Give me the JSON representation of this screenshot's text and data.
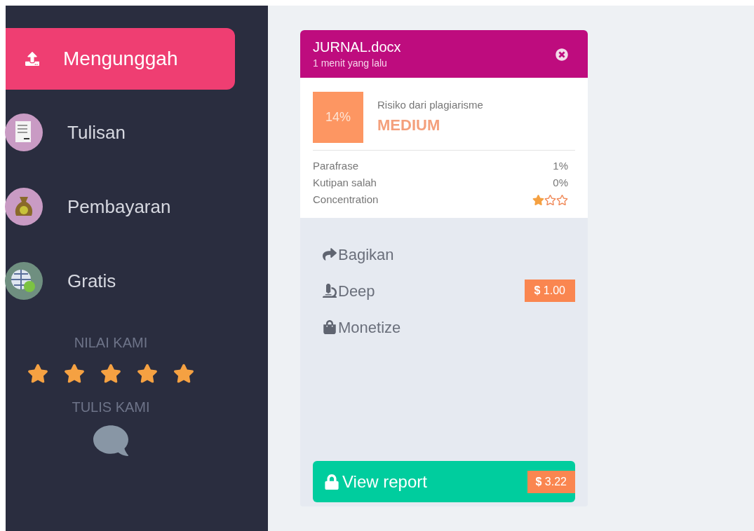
{
  "sidebar": {
    "items": [
      {
        "label": "Mengunggah",
        "kind": "upload",
        "selected": true
      },
      {
        "label": "Tulisan",
        "kind": "document",
        "selected": false
      },
      {
        "label": "Pembayaran",
        "kind": "money",
        "selected": false
      },
      {
        "label": "Gratis",
        "kind": "free",
        "selected": false
      }
    ],
    "rate": {
      "title": "NILAI KAMI",
      "stars": 5
    },
    "write": {
      "title": "TULIS KAMI"
    }
  },
  "card": {
    "title": "JURNAL.docx",
    "time": "1 menit yang lalu",
    "score": "14%",
    "risk_label": "Risiko dari plagiarisme",
    "risk_level": "MEDIUM",
    "stats": [
      {
        "kind": "text",
        "label": "Parafrase",
        "value": "1%"
      },
      {
        "kind": "text",
        "label": "Kutipan salah",
        "value": "0%"
      },
      {
        "kind": "stars",
        "label": "Concentration",
        "stars": 1
      }
    ],
    "actions": [
      {
        "kind": "share",
        "label": "Bagikan"
      },
      {
        "kind": "deep",
        "label": "Deep",
        "price": "**$** 1.00"
      },
      {
        "kind": "monetize",
        "label": "Monetize"
      }
    ],
    "report": {
      "label": "View report",
      "price": "**$** 3.22"
    }
  }
}
